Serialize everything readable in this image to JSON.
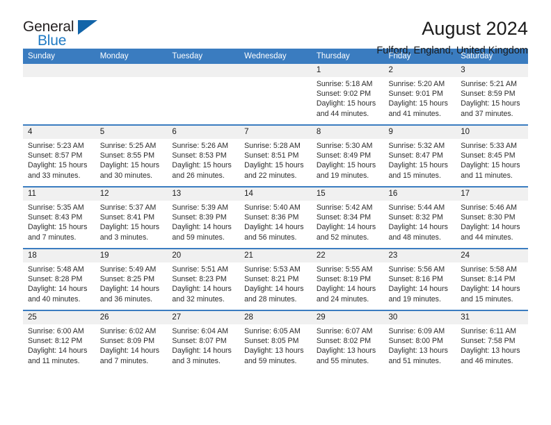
{
  "logo": {
    "line1": "General",
    "line2": "Blue",
    "triangle_color": "#1264a8",
    "blue_color": "#1f7ac4"
  },
  "header": {
    "title": "August 2024",
    "subtitle": "Fulford, England, United Kingdom"
  },
  "theme": {
    "header_blue": "#3a7cc0",
    "daynum_bg": "#f0f0f0"
  },
  "weekday_headers": [
    "Sunday",
    "Monday",
    "Tuesday",
    "Wednesday",
    "Thursday",
    "Friday",
    "Saturday"
  ],
  "labels": {
    "sunrise_prefix": "Sunrise: ",
    "sunset_prefix": "Sunset: ",
    "daylight_prefix": "Daylight: "
  },
  "weeks": [
    [
      {
        "day": "",
        "empty": true
      },
      {
        "day": "",
        "empty": true
      },
      {
        "day": "",
        "empty": true
      },
      {
        "day": "",
        "empty": true
      },
      {
        "day": "1",
        "sunrise": "Sunrise: 5:18 AM",
        "sunset": "Sunset: 9:02 PM",
        "daylight_line1": "Daylight: 15 hours",
        "daylight_line2": "and 44 minutes."
      },
      {
        "day": "2",
        "sunrise": "Sunrise: 5:20 AM",
        "sunset": "Sunset: 9:01 PM",
        "daylight_line1": "Daylight: 15 hours",
        "daylight_line2": "and 41 minutes."
      },
      {
        "day": "3",
        "sunrise": "Sunrise: 5:21 AM",
        "sunset": "Sunset: 8:59 PM",
        "daylight_line1": "Daylight: 15 hours",
        "daylight_line2": "and 37 minutes."
      }
    ],
    [
      {
        "day": "4",
        "sunrise": "Sunrise: 5:23 AM",
        "sunset": "Sunset: 8:57 PM",
        "daylight_line1": "Daylight: 15 hours",
        "daylight_line2": "and 33 minutes."
      },
      {
        "day": "5",
        "sunrise": "Sunrise: 5:25 AM",
        "sunset": "Sunset: 8:55 PM",
        "daylight_line1": "Daylight: 15 hours",
        "daylight_line2": "and 30 minutes."
      },
      {
        "day": "6",
        "sunrise": "Sunrise: 5:26 AM",
        "sunset": "Sunset: 8:53 PM",
        "daylight_line1": "Daylight: 15 hours",
        "daylight_line2": "and 26 minutes."
      },
      {
        "day": "7",
        "sunrise": "Sunrise: 5:28 AM",
        "sunset": "Sunset: 8:51 PM",
        "daylight_line1": "Daylight: 15 hours",
        "daylight_line2": "and 22 minutes."
      },
      {
        "day": "8",
        "sunrise": "Sunrise: 5:30 AM",
        "sunset": "Sunset: 8:49 PM",
        "daylight_line1": "Daylight: 15 hours",
        "daylight_line2": "and 19 minutes."
      },
      {
        "day": "9",
        "sunrise": "Sunrise: 5:32 AM",
        "sunset": "Sunset: 8:47 PM",
        "daylight_line1": "Daylight: 15 hours",
        "daylight_line2": "and 15 minutes."
      },
      {
        "day": "10",
        "sunrise": "Sunrise: 5:33 AM",
        "sunset": "Sunset: 8:45 PM",
        "daylight_line1": "Daylight: 15 hours",
        "daylight_line2": "and 11 minutes."
      }
    ],
    [
      {
        "day": "11",
        "sunrise": "Sunrise: 5:35 AM",
        "sunset": "Sunset: 8:43 PM",
        "daylight_line1": "Daylight: 15 hours",
        "daylight_line2": "and 7 minutes."
      },
      {
        "day": "12",
        "sunrise": "Sunrise: 5:37 AM",
        "sunset": "Sunset: 8:41 PM",
        "daylight_line1": "Daylight: 15 hours",
        "daylight_line2": "and 3 minutes."
      },
      {
        "day": "13",
        "sunrise": "Sunrise: 5:39 AM",
        "sunset": "Sunset: 8:39 PM",
        "daylight_line1": "Daylight: 14 hours",
        "daylight_line2": "and 59 minutes."
      },
      {
        "day": "14",
        "sunrise": "Sunrise: 5:40 AM",
        "sunset": "Sunset: 8:36 PM",
        "daylight_line1": "Daylight: 14 hours",
        "daylight_line2": "and 56 minutes."
      },
      {
        "day": "15",
        "sunrise": "Sunrise: 5:42 AM",
        "sunset": "Sunset: 8:34 PM",
        "daylight_line1": "Daylight: 14 hours",
        "daylight_line2": "and 52 minutes."
      },
      {
        "day": "16",
        "sunrise": "Sunrise: 5:44 AM",
        "sunset": "Sunset: 8:32 PM",
        "daylight_line1": "Daylight: 14 hours",
        "daylight_line2": "and 48 minutes."
      },
      {
        "day": "17",
        "sunrise": "Sunrise: 5:46 AM",
        "sunset": "Sunset: 8:30 PM",
        "daylight_line1": "Daylight: 14 hours",
        "daylight_line2": "and 44 minutes."
      }
    ],
    [
      {
        "day": "18",
        "sunrise": "Sunrise: 5:48 AM",
        "sunset": "Sunset: 8:28 PM",
        "daylight_line1": "Daylight: 14 hours",
        "daylight_line2": "and 40 minutes."
      },
      {
        "day": "19",
        "sunrise": "Sunrise: 5:49 AM",
        "sunset": "Sunset: 8:25 PM",
        "daylight_line1": "Daylight: 14 hours",
        "daylight_line2": "and 36 minutes."
      },
      {
        "day": "20",
        "sunrise": "Sunrise: 5:51 AM",
        "sunset": "Sunset: 8:23 PM",
        "daylight_line1": "Daylight: 14 hours",
        "daylight_line2": "and 32 minutes."
      },
      {
        "day": "21",
        "sunrise": "Sunrise: 5:53 AM",
        "sunset": "Sunset: 8:21 PM",
        "daylight_line1": "Daylight: 14 hours",
        "daylight_line2": "and 28 minutes."
      },
      {
        "day": "22",
        "sunrise": "Sunrise: 5:55 AM",
        "sunset": "Sunset: 8:19 PM",
        "daylight_line1": "Daylight: 14 hours",
        "daylight_line2": "and 24 minutes."
      },
      {
        "day": "23",
        "sunrise": "Sunrise: 5:56 AM",
        "sunset": "Sunset: 8:16 PM",
        "daylight_line1": "Daylight: 14 hours",
        "daylight_line2": "and 19 minutes."
      },
      {
        "day": "24",
        "sunrise": "Sunrise: 5:58 AM",
        "sunset": "Sunset: 8:14 PM",
        "daylight_line1": "Daylight: 14 hours",
        "daylight_line2": "and 15 minutes."
      }
    ],
    [
      {
        "day": "25",
        "sunrise": "Sunrise: 6:00 AM",
        "sunset": "Sunset: 8:12 PM",
        "daylight_line1": "Daylight: 14 hours",
        "daylight_line2": "and 11 minutes."
      },
      {
        "day": "26",
        "sunrise": "Sunrise: 6:02 AM",
        "sunset": "Sunset: 8:09 PM",
        "daylight_line1": "Daylight: 14 hours",
        "daylight_line2": "and 7 minutes."
      },
      {
        "day": "27",
        "sunrise": "Sunrise: 6:04 AM",
        "sunset": "Sunset: 8:07 PM",
        "daylight_line1": "Daylight: 14 hours",
        "daylight_line2": "and 3 minutes."
      },
      {
        "day": "28",
        "sunrise": "Sunrise: 6:05 AM",
        "sunset": "Sunset: 8:05 PM",
        "daylight_line1": "Daylight: 13 hours",
        "daylight_line2": "and 59 minutes."
      },
      {
        "day": "29",
        "sunrise": "Sunrise: 6:07 AM",
        "sunset": "Sunset: 8:02 PM",
        "daylight_line1": "Daylight: 13 hours",
        "daylight_line2": "and 55 minutes."
      },
      {
        "day": "30",
        "sunrise": "Sunrise: 6:09 AM",
        "sunset": "Sunset: 8:00 PM",
        "daylight_line1": "Daylight: 13 hours",
        "daylight_line2": "and 51 minutes."
      },
      {
        "day": "31",
        "sunrise": "Sunrise: 6:11 AM",
        "sunset": "Sunset: 7:58 PM",
        "daylight_line1": "Daylight: 13 hours",
        "daylight_line2": "and 46 minutes."
      }
    ]
  ]
}
